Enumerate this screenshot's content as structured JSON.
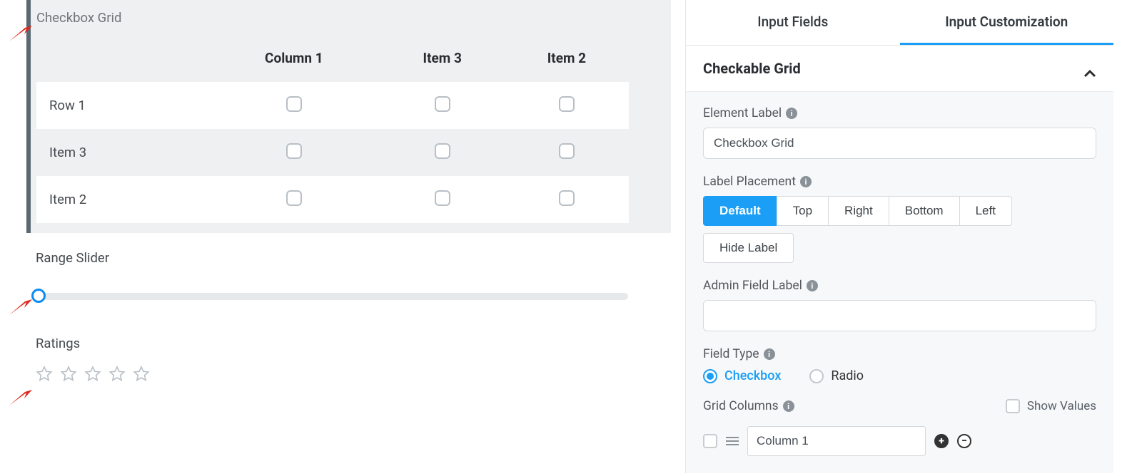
{
  "left": {
    "checkbox_grid": {
      "label": "Checkbox Grid",
      "columns": [
        "Column 1",
        "Item 3",
        "Item 2"
      ],
      "rows": [
        "Row 1",
        "Item 3",
        "Item 2"
      ]
    },
    "range_slider": {
      "label": "Range Slider",
      "value_percent": 0
    },
    "ratings": {
      "label": "Ratings",
      "stars": 5,
      "value": 0
    }
  },
  "panel": {
    "tabs": {
      "input_fields": "Input Fields",
      "input_customization": "Input Customization",
      "active": "input_customization"
    },
    "section_title": "Checkable Grid",
    "element_label": {
      "label": "Element Label",
      "value": "Checkbox Grid"
    },
    "label_placement": {
      "label": "Label Placement",
      "options": [
        "Default",
        "Top",
        "Right",
        "Bottom",
        "Left",
        "Hide Label"
      ],
      "active": "Default"
    },
    "admin_field_label": {
      "label": "Admin Field Label",
      "value": ""
    },
    "field_type": {
      "label": "Field Type",
      "options": {
        "checkbox": "Checkbox",
        "radio": "Radio"
      },
      "active": "checkbox"
    },
    "grid_columns": {
      "label": "Grid Columns",
      "show_values_label": "Show Values",
      "show_values": false,
      "items": [
        "Column 1"
      ]
    }
  }
}
